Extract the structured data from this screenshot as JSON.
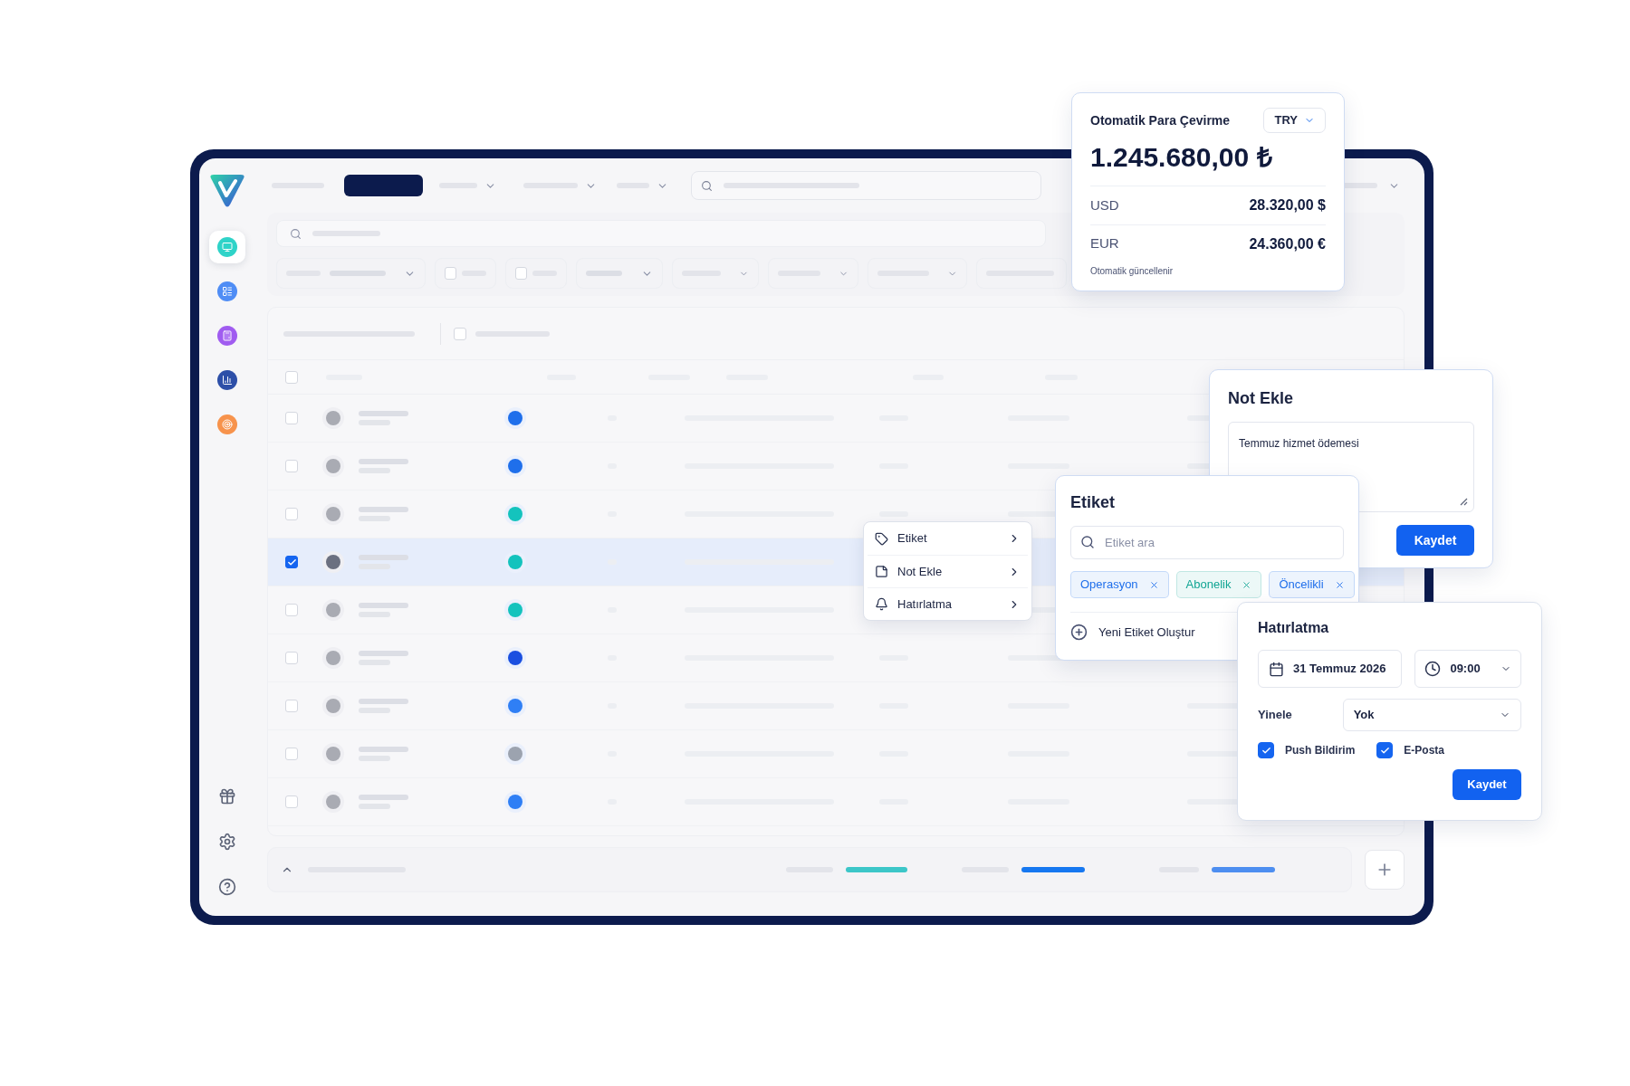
{
  "sidebar": {
    "items": [
      {
        "color": "#2fd3c8",
        "selected": true
      },
      {
        "color": "#4f8df5",
        "selected": false
      },
      {
        "color": "#a05cf0",
        "selected": false
      },
      {
        "color": "#2d4fa8",
        "selected": false
      },
      {
        "color": "#f7934c",
        "selected": false
      }
    ]
  },
  "filters": {
    "toggles": [
      {
        "checked": false
      },
      {
        "checked": false
      }
    ]
  },
  "table": {
    "toolbar_checkbox": {
      "checked": false
    },
    "header_checkbox": {
      "checked": false
    },
    "rows": [
      {
        "checked": false,
        "selected": false,
        "color": "#1f6feb"
      },
      {
        "checked": false,
        "selected": false,
        "color": "#1f6feb"
      },
      {
        "checked": false,
        "selected": false,
        "color": "#14c3bd"
      },
      {
        "checked": true,
        "selected": true,
        "color": "#14c3bd"
      },
      {
        "checked": false,
        "selected": false,
        "color": "#14c3bd"
      },
      {
        "checked": false,
        "selected": false,
        "color": "#1a4fe0"
      },
      {
        "checked": false,
        "selected": false,
        "color": "#2f7ff5"
      },
      {
        "checked": false,
        "selected": false,
        "color": "#9ca3af"
      },
      {
        "checked": false,
        "selected": false,
        "color": "#2f7ff5"
      }
    ]
  },
  "currency_card": {
    "title": "Otomatik Para Çevirme",
    "currency": "TRY",
    "amount": "1.245.680,00 ₺",
    "rows": [
      {
        "code": "USD",
        "value": "28.320,00 $"
      },
      {
        "code": "EUR",
        "value": "24.360,00 €"
      }
    ],
    "note": "Otomatik güncellenir"
  },
  "context_menu": {
    "items": [
      {
        "label": "Etiket",
        "kind": "tag"
      },
      {
        "label": "Not Ekle",
        "kind": "note"
      },
      {
        "label": "Hatırlatma",
        "kind": "reminder"
      }
    ]
  },
  "note_card": {
    "title": "Not Ekle",
    "value": "Temmuz hizmet ödemesi",
    "button": "Kaydet"
  },
  "tag_card": {
    "title": "Etiket",
    "placeholder": "Etiket ara",
    "tags": [
      {
        "label": "Operasyon",
        "color": "#1f6feb"
      },
      {
        "label": "Abonelik",
        "color": "#12a594"
      },
      {
        "label": "Öncelikli",
        "color": "#1f6feb"
      }
    ],
    "create": "Yeni Etiket Oluştur"
  },
  "reminder_card": {
    "title": "Hatırlatma",
    "date": "31 Temmuz 2026",
    "time": "09:00",
    "repeat_label": "Yinele",
    "repeat": "Yok",
    "options": [
      {
        "label": "Push Bildirim",
        "checked": true
      },
      {
        "label": "E-Posta",
        "checked": true
      }
    ],
    "button": "Kaydet"
  }
}
